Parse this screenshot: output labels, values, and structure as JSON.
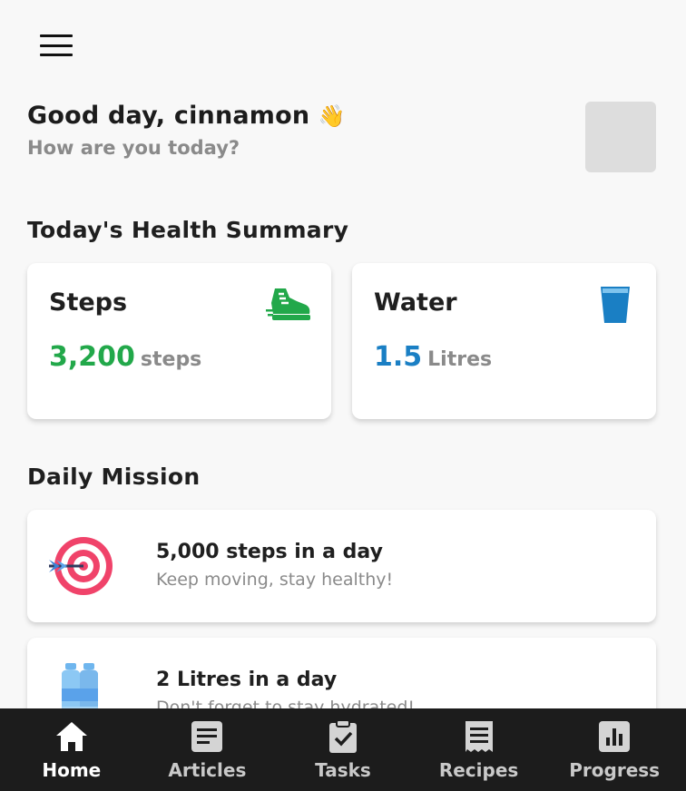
{
  "header": {
    "menu_icon": "hamburger-menu-icon"
  },
  "greeting": {
    "title": "Good day, cinnamon",
    "emoji": "👋",
    "subtitle": "How are you today?"
  },
  "summary": {
    "title": "Today's Health Summary",
    "steps": {
      "label": "Steps",
      "value": "3,200",
      "unit": "steps",
      "color": "#22a84a",
      "icon": "sneaker-icon"
    },
    "water": {
      "label": "Water",
      "value": "1.5",
      "unit": "Litres",
      "color": "#1a7fc4",
      "icon": "water-glass-icon"
    }
  },
  "mission": {
    "title": "Daily Mission",
    "items": [
      {
        "title": "5,000 steps in a day",
        "subtitle": "Keep moving, stay healthy!",
        "icon": "target-icon"
      },
      {
        "title": "2 Litres in a day",
        "subtitle": "Don't forget to stay hydrated!",
        "icon": "water-bottles-icon"
      }
    ]
  },
  "nav": {
    "items": [
      {
        "label": "Home",
        "icon": "home-icon",
        "active": true
      },
      {
        "label": "Articles",
        "icon": "article-icon"
      },
      {
        "label": "Tasks",
        "icon": "tasks-clipboard-icon"
      },
      {
        "label": "Recipes",
        "icon": "recipe-receipt-icon"
      },
      {
        "label": "Progress",
        "icon": "progress-chart-icon"
      }
    ]
  }
}
